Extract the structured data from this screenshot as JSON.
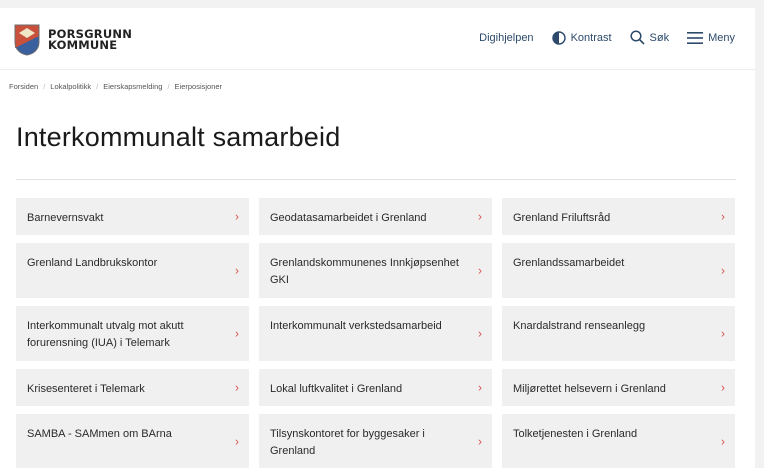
{
  "header": {
    "logo_line1": "PORSGRUNN",
    "logo_line2": "KOMMUNE",
    "nav": {
      "help": "Digihjelpen",
      "contrast": "Kontrast",
      "search": "Søk",
      "menu": "Meny"
    }
  },
  "breadcrumb": [
    "Forsiden",
    "Lokalpolitikk",
    "Eierskapsmelding",
    "Eierposisjoner"
  ],
  "page_title": "Interkommunalt samarbeid",
  "cards": [
    "Barnevernsvakt",
    "Geodatasamarbeidet i Grenland",
    "Grenland Friluftsråd",
    "Grenland Landbrukskontor",
    "Grenlandskommunenes Innkjøpsenhet GKI",
    "Grenlandssamarbeidet",
    "Interkommunalt utvalg mot akutt forurensning (IUA) i Telemark",
    "Interkommunalt verkstedsamarbeid",
    "Knardalstrand renseanlegg",
    "Krisesenteret i Telemark",
    "Lokal luftkvalitet i Grenland",
    "Miljørettet helsevern i Grenland",
    "SAMBA - SAMmen om BArna",
    "Tilsynskontoret for byggesaker i Grenland",
    "Tolketjenesten i Grenland"
  ],
  "colors": {
    "accent_chevron": "#d9534f",
    "nav_text": "#2d4a6b",
    "card_bg": "#f0f0f0"
  }
}
